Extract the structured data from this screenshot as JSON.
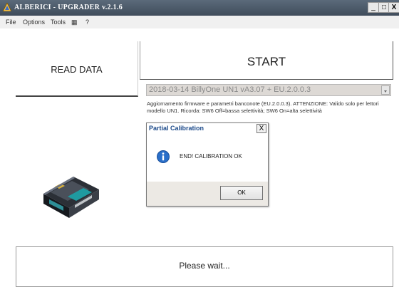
{
  "window": {
    "title": "ALBERICI - UPGRADER v.2.1.6",
    "controls": {
      "minimize": "_",
      "maximize": "□",
      "close": "X"
    }
  },
  "menu": {
    "items": [
      "File",
      "Options",
      "Tools",
      "▦",
      "?"
    ]
  },
  "buttons": {
    "read_data": "READ DATA",
    "start": "START"
  },
  "firmware_select": {
    "selected": "2018-03-14 BillyOne UN1 vA3.07 + EU.2.0.0.3"
  },
  "description": "Aggiornamento firmware e parametri banconote (EU.2.0.0.3). ATTENZIONE: Valido solo per lettori modello UN1. Ricorda: SW6 Off=bassa selettività; SW6 On=alta selettività",
  "dialog": {
    "title": "Partial Calibration",
    "message": "END! CALIBRATION OK",
    "ok_label": "OK",
    "close_label": "X",
    "icon": "info-icon"
  },
  "status": {
    "text": "Please wait..."
  },
  "colors": {
    "titlebar": "#46535f",
    "dialog_title_text": "#1c4a8a",
    "info_icon": "#2a6fc9"
  }
}
